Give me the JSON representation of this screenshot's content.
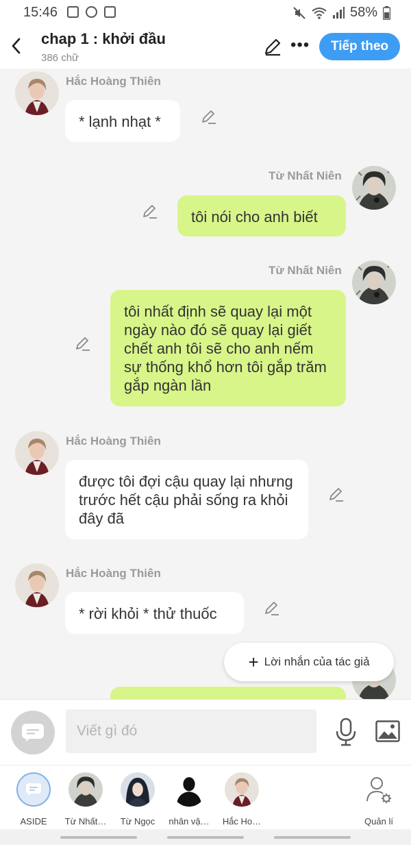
{
  "status_bar": {
    "time": "15:46",
    "battery": "58%"
  },
  "header": {
    "title": "chap 1 : khởi đầu",
    "subtitle": "386 chữ",
    "next_label": "Tiếp theo"
  },
  "messages": [
    {
      "sender": "Hắc Hoàng Thiên",
      "side": "left",
      "text": "* lạnh nhạt *"
    },
    {
      "sender": "Từ Nhất Niên",
      "side": "right",
      "text": "tôi nói cho anh biết"
    },
    {
      "sender": "Từ Nhất Niên",
      "side": "right",
      "text": "tôi nhất định sẽ quay lại một ngày nào đó sẽ quay lại giết chết anh tôi sẽ cho anh nếm sự thống khổ hơn tôi gắp trăm gắp ngàn lần"
    },
    {
      "sender": "Hắc Hoàng Thiên",
      "side": "left",
      "text": "được tôi đợi cậu quay lại nhưng trước hết cậu phải sống ra khỏi đây đã"
    },
    {
      "sender": "Hắc Hoàng Thiên",
      "side": "left",
      "text": "* rời khỏi * thử thuốc"
    }
  ],
  "author_note_label": "Lời nhắn của tác giả",
  "input": {
    "placeholder": "Viết gì đó"
  },
  "characters": [
    {
      "label": "ASIDE"
    },
    {
      "label": "Từ Nhất…"
    },
    {
      "label": "Từ Ngọc"
    },
    {
      "label": "nhân vậ…"
    },
    {
      "label": "Hắc Ho…"
    }
  ],
  "manage_label": "Quản lí",
  "colors": {
    "accent": "#3d9df5",
    "right_bubble": "#d8f589",
    "left_bubble": "#ffffff"
  }
}
